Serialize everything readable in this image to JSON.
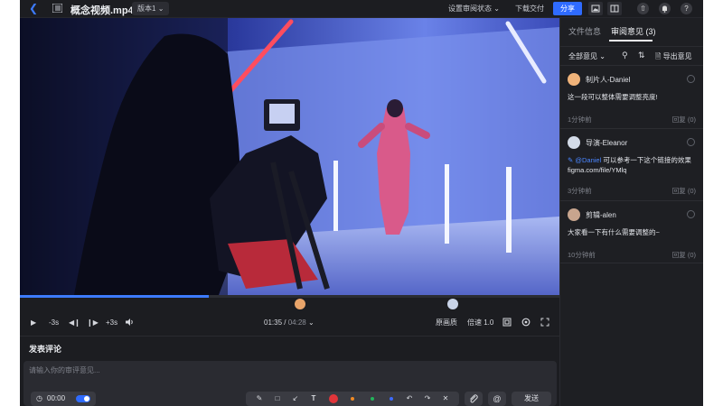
{
  "topbar": {
    "back_icon": "chevron-left-icon",
    "list_icon": "playlist-icon",
    "file_name": "概念视频.mp4",
    "version": "版本1",
    "review_status": "设置审阅状态",
    "download": "下载交付",
    "share": "分享",
    "accent_color": "#2f6bff"
  },
  "player": {
    "current_time": "01:35",
    "duration": "04:28",
    "progress": 0.35,
    "skip_back": "-3s",
    "skip_forward": "+3s",
    "quality": "原画质",
    "speed": "倍速 1.0"
  },
  "comment_form": {
    "title": "发表评论",
    "placeholder": "请输入你的审评意见...",
    "timestamp": "00:00",
    "send": "发送",
    "colors": [
      "#e0353a",
      "#f08a24",
      "#23b45a",
      "#3d6bff"
    ]
  },
  "panel": {
    "tab_files": "文件信息",
    "tab_comments": "审阅意见 (3)",
    "filter": "全部意见",
    "export": "导出意见",
    "comments": [
      {
        "author": "制片人-Daniel",
        "text": "这一段可以整体需要调整亮度!",
        "mention": "",
        "text2": "",
        "time": "1分钟前",
        "reply": "回复 (0)"
      },
      {
        "author": "导演-Eleanor",
        "text": "",
        "mention": "@Daniel",
        "text2": " 可以参考一下这个链接的效果 figma.com/file/YMlq",
        "time": "3分钟前",
        "reply": "回复 (0)"
      },
      {
        "author": "剪辑-alen",
        "text": "大家看一下有什么需要调整的~",
        "mention": "",
        "text2": "",
        "time": "10分钟前",
        "reply": "回复 (0)"
      }
    ]
  }
}
